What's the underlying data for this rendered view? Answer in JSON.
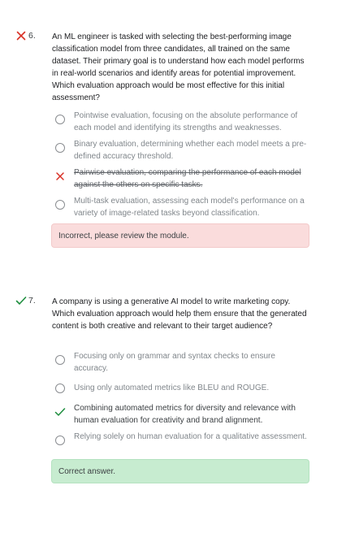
{
  "questions": [
    {
      "number": "6.",
      "status": "incorrect",
      "status_icon": "x-icon",
      "text": "An ML engineer is tasked with selecting the best-performing image classification model from three candidates, all trained on the same dataset. Their primary goal is to understand how each model performs in real-world scenarios and identify areas for potential improvement. Which evaluation approach would be most effective for this initial assessment?",
      "options": [
        {
          "text": "Pointwise evaluation, focusing on the absolute performance of each model and identifying its strengths and weaknesses.",
          "state": "unselected"
        },
        {
          "text": "Binary evaluation, determining whether each model meets a pre-defined accuracy threshold.",
          "state": "unselected"
        },
        {
          "text": "Pairwise evaluation, comparing the performance of each model against the others on specific tasks.",
          "state": "selected-wrong"
        },
        {
          "text": "Multi-task evaluation, assessing each model's performance on a variety of image-related tasks beyond classification.",
          "state": "unselected"
        }
      ],
      "feedback": "Incorrect, please review the module."
    },
    {
      "number": "7.",
      "status": "correct",
      "status_icon": "check-icon",
      "text": "A company is using a generative AI model to write marketing copy. Which evaluation approach would help them ensure that the generated content is both creative and relevant to their target audience?",
      "options": [
        {
          "text": "Focusing only on grammar and syntax checks to ensure accuracy.",
          "state": "unselected"
        },
        {
          "text": "Using only automated metrics like BLEU and ROUGE.",
          "state": "unselected"
        },
        {
          "text": "Combining automated metrics for diversity and relevance with human evaluation for creativity and brand alignment.",
          "state": "selected-correct"
        },
        {
          "text": "Relying solely on human evaluation for a qualitative assessment.",
          "state": "unselected"
        }
      ],
      "feedback": "Correct answer."
    }
  ],
  "colors": {
    "incorrect": "#d93025",
    "correct": "#1e8e3e",
    "incorrect_bg": "#fadcdc",
    "correct_bg": "#c7ecd0"
  }
}
